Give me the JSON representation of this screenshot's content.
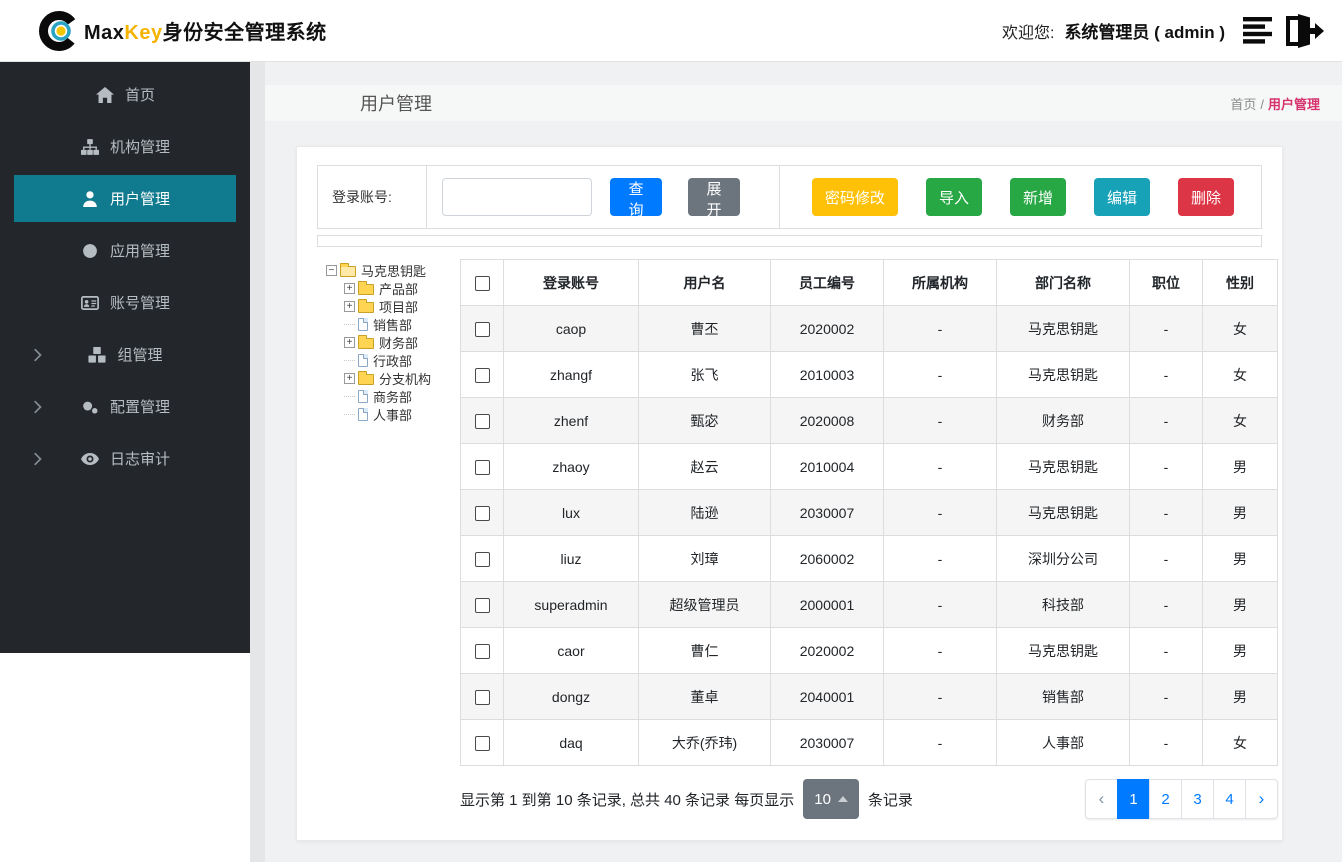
{
  "colors": {
    "sidebar_bg": "#23272b",
    "sidebar_active": "#107a8e",
    "primary": "#007bff",
    "breadcrumb_active": "#d6336c",
    "brand_key": "#f5b301",
    "page_size_bg": "#6c757d"
  },
  "header": {
    "brand": {
      "max": "Max",
      "key": "Key",
      "suffix": "身份安全管理系统"
    },
    "welcome_label": "欢迎您:",
    "user": "系统管理员 ( admin )"
  },
  "sidebar": {
    "items": [
      {
        "id": "home",
        "label": "首页",
        "icon": "home-icon",
        "active": false,
        "expandable": false
      },
      {
        "id": "org",
        "label": "机构管理",
        "icon": "sitemap-icon",
        "active": false,
        "expandable": false
      },
      {
        "id": "user",
        "label": "用户管理",
        "icon": "user-icon",
        "active": true,
        "expandable": false
      },
      {
        "id": "app",
        "label": "应用管理",
        "icon": "globe-icon",
        "active": false,
        "expandable": false
      },
      {
        "id": "account",
        "label": "账号管理",
        "icon": "id-card-icon",
        "active": false,
        "expandable": false
      },
      {
        "id": "group",
        "label": "组管理",
        "icon": "cubes-icon",
        "active": false,
        "expandable": true
      },
      {
        "id": "config",
        "label": "配置管理",
        "icon": "gears-icon",
        "active": false,
        "expandable": true
      },
      {
        "id": "audit",
        "label": "日志审计",
        "icon": "eye-icon",
        "active": false,
        "expandable": true
      }
    ]
  },
  "page": {
    "title": "用户管理",
    "breadcrumb": {
      "home": "首页",
      "separator": "/",
      "current": "用户管理"
    }
  },
  "toolbar": {
    "search_label": "登录账号:",
    "search_value": "",
    "query_label": "查询",
    "expand_label": "展开",
    "actions": [
      {
        "id": "change-password",
        "label": "密码修改",
        "color": "#ffc107"
      },
      {
        "id": "import",
        "label": "导入",
        "color": "#28a745"
      },
      {
        "id": "add",
        "label": "新增",
        "color": "#28a745"
      },
      {
        "id": "edit",
        "label": "编辑",
        "color": "#17a2b8"
      },
      {
        "id": "delete",
        "label": "删除",
        "color": "#dc3545"
      }
    ]
  },
  "tree": {
    "root": {
      "label": "马克思钥匙",
      "type": "folder-open",
      "expander": "collapse"
    },
    "children": [
      {
        "label": "产品部",
        "type": "folder",
        "expander": "expand"
      },
      {
        "label": "项目部",
        "type": "folder",
        "expander": "expand"
      },
      {
        "label": "销售部",
        "type": "file",
        "expander": "none"
      },
      {
        "label": "财务部",
        "type": "folder",
        "expander": "expand"
      },
      {
        "label": "行政部",
        "type": "file",
        "expander": "none"
      },
      {
        "label": "分支机构",
        "type": "folder",
        "expander": "expand"
      },
      {
        "label": "商务部",
        "type": "file",
        "expander": "none"
      },
      {
        "label": "人事部",
        "type": "file",
        "expander": "none"
      }
    ]
  },
  "table": {
    "columns": [
      "登录账号",
      "用户名",
      "员工编号",
      "所属机构",
      "部门名称",
      "职位",
      "性别"
    ],
    "rows": [
      [
        "caop",
        "曹丕",
        "2020002",
        "-",
        "马克思钥匙",
        "-",
        "女"
      ],
      [
        "zhangf",
        "张飞",
        "2010003",
        "-",
        "马克思钥匙",
        "-",
        "女"
      ],
      [
        "zhenf",
        "甄宓",
        "2020008",
        "-",
        "财务部",
        "-",
        "女"
      ],
      [
        "zhaoy",
        "赵云",
        "2010004",
        "-",
        "马克思钥匙",
        "-",
        "男"
      ],
      [
        "lux",
        "陆逊",
        "2030007",
        "-",
        "马克思钥匙",
        "-",
        "男"
      ],
      [
        "liuz",
        "刘璋",
        "2060002",
        "-",
        "深圳分公司",
        "-",
        "男"
      ],
      [
        "superadmin",
        "超级管理员",
        "2000001",
        "-",
        "科技部",
        "-",
        "男"
      ],
      [
        "caor",
        "曹仁",
        "2020002",
        "-",
        "马克思钥匙",
        "-",
        "男"
      ],
      [
        "dongz",
        "董卓",
        "2040001",
        "-",
        "销售部",
        "-",
        "男"
      ],
      [
        "daq",
        "大乔(乔玮)",
        "2030007",
        "-",
        "人事部",
        "-",
        "女"
      ]
    ]
  },
  "footer": {
    "info_prefix": "显示第 1 到第 10 条记录, 总共 40 条记录 每页显示",
    "page_size": "10",
    "info_suffix": "条记录",
    "pagination": {
      "prev": "‹",
      "pages": [
        "1",
        "2",
        "3",
        "4"
      ],
      "active": "1",
      "next": "›"
    }
  }
}
